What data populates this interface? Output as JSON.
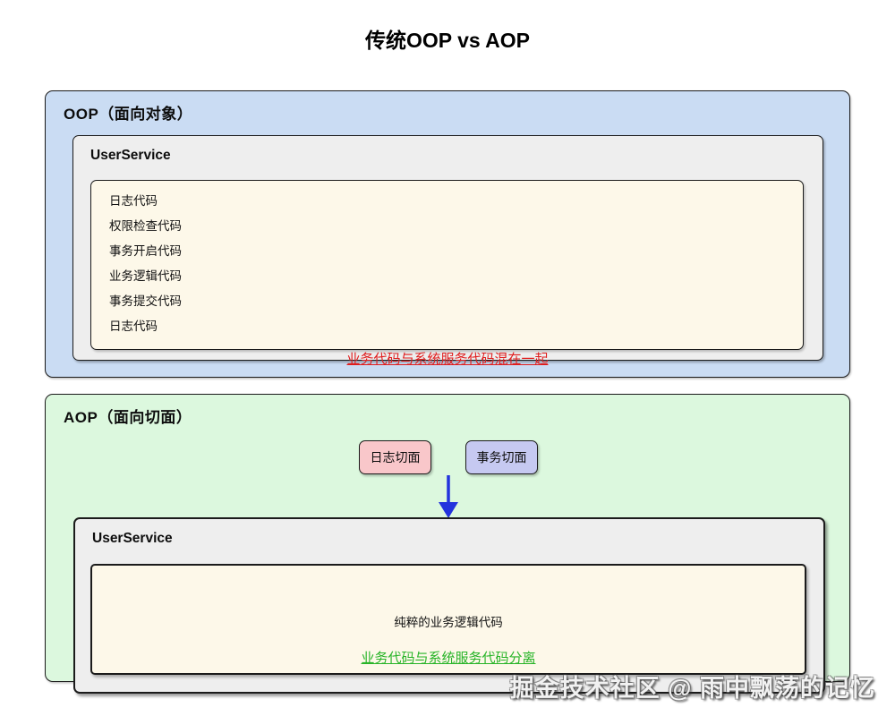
{
  "title": "传统OOP vs AOP",
  "oop": {
    "label": "OOP（面向对象）",
    "service": {
      "name": "UserService",
      "code_lines": [
        "日志代码",
        "权限检查代码",
        "事务开启代码",
        "业务逻辑代码",
        "事务提交代码",
        "日志代码"
      ]
    },
    "caption": "业务代码与系统服务代码混在一起",
    "colors": {
      "panel_bg": "#cadcf3",
      "service_bg": "#eeeeee",
      "code_bg": "#fdf8e9",
      "caption": "#e01d1d"
    }
  },
  "aop": {
    "label": "AOP（面向切面）",
    "aspects": [
      {
        "label": "日志切面",
        "bg": "#f9c7ca"
      },
      {
        "label": "事务切面",
        "bg": "#c6c9f1"
      }
    ],
    "arrow_color": "#2333dd",
    "service": {
      "name": "UserService",
      "body": "纯粹的业务逻辑代码",
      "caption": "业务代码与系统服务代码分离"
    },
    "colors": {
      "panel_bg": "#dcf8de",
      "service_bg": "#eeeeee",
      "code_bg": "#fdf8e9",
      "caption": "#28b428"
    }
  },
  "watermark": "掘金技术社区 @ 雨中飘荡的记忆"
}
